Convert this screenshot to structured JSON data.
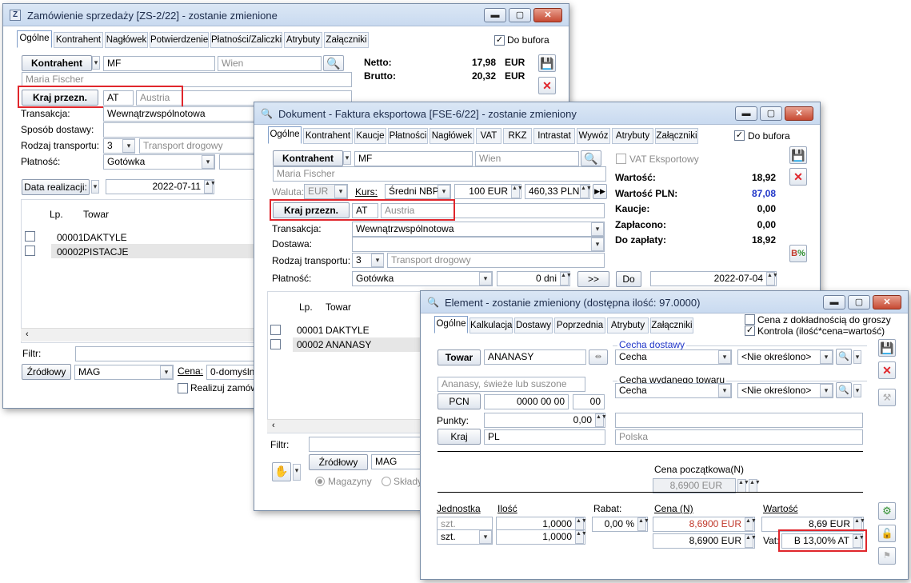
{
  "colors": {
    "accent": "#1f35c8",
    "red": "#e0262c",
    "red_text": "#c0392b"
  },
  "win1": {
    "title": "Zamówienie sprzedaży [ZS-2/22] - zostanie zmienione",
    "tabs": [
      "Ogólne",
      "Kontrahent",
      "Nagłówek",
      "Potwierdzenie",
      "Płatności/Zaliczki",
      "Atrybuty",
      "Załączniki"
    ],
    "do_bufora": "Do bufora",
    "kontrahent_btn": "Kontrahent",
    "kontrahent_code": "MF",
    "kontrahent_city": "Wien",
    "kontrahent_name": "Maria Fischer",
    "netto_label": "Netto:",
    "netto_value": "17,98",
    "netto_cur": "EUR",
    "brutto_label": "Brutto:",
    "brutto_value": "20,32",
    "brutto_cur": "EUR",
    "kraj_btn": "Kraj przezn.",
    "kraj_code": "AT",
    "kraj_name": "Austria",
    "transakcja_label": "Transakcja:",
    "transakcja_value": "Wewnątrzwspólnotowa",
    "sposob_label": "Sposób dostawy:",
    "rodzaj_label": "Rodzaj transportu:",
    "rodzaj_num": "3",
    "rodzaj_value": "Transport drogowy",
    "platnosc_label": "Płatność:",
    "platnosc_value": "Gotówka",
    "data_btn": "Data realizacji:",
    "data_value": "2022-07-11",
    "col_lp": "Lp.",
    "col_towar": "Towar",
    "rows": [
      {
        "lp": "00001",
        "towar": "DAKTYLE"
      },
      {
        "lp": "00002",
        "towar": "PISTACJE"
      }
    ],
    "filtr_label": "Filtr:",
    "zrodlowy_btn": "Źródłowy",
    "mag": "MAG",
    "cena_label": "Cena:",
    "cena_value": "0-domyślna",
    "realizuj": "Realizuj zamówie"
  },
  "win2": {
    "title": "Dokument - Faktura eksportowa [FSE-6/22]  - zostanie zmieniony",
    "tabs": [
      "Ogólne",
      "Kontrahent",
      "Kaucje",
      "Płatności",
      "Nagłówek",
      "VAT",
      "RKZ",
      "Intrastat",
      "Wywóz",
      "Atrybuty",
      "Załączniki"
    ],
    "do_bufora": "Do bufora",
    "kontrahent_btn": "Kontrahent",
    "kontrahent_code": "MF",
    "kontrahent_city": "Wien",
    "kontrahent_name": "Maria Fischer",
    "vat_eksport": "VAT Eksportowy",
    "waluta_label": "Waluta:",
    "waluta_value": "EUR",
    "kurs_label": "Kurs:",
    "kurs_value": "Średni NBP",
    "kurs_amount": "100 EUR",
    "kurs_pln": "460,33 PLN",
    "kraj_btn": "Kraj przezn.",
    "kraj_code": "AT",
    "kraj_name": "Austria",
    "transakcja_label": "Transakcja:",
    "transakcja_value": "Wewnątrzwspólnotowa",
    "dostawa_label": "Dostawa:",
    "rodzaj_label": "Rodzaj transportu:",
    "rodzaj_num": "3",
    "rodzaj_value": "Transport drogowy",
    "platnosc_label": "Płatność:",
    "platnosc_value": "Gotówka",
    "dni": "0 dni",
    "arrow_btn": ">>",
    "do_btn": "Do",
    "do_date": "2022-07-04",
    "wartosc_label": "Wartość:",
    "wartosc_value": "18,92",
    "wartosc_pln_label": "Wartość PLN:",
    "wartosc_pln_value": "87,08",
    "kaucje_label": "Kaucje:",
    "kaucje_value": "0,00",
    "zaplacono_label": "Zapłacono:",
    "zaplacono_value": "0,00",
    "do_zaplaty_label": "Do zapłaty:",
    "do_zaplaty_value": "18,92",
    "col_lp": "Lp.",
    "col_towar": "Towar",
    "rows": [
      {
        "lp": "00001",
        "towar": "DAKTYLE"
      },
      {
        "lp": "00002",
        "towar": "ANANASY"
      }
    ],
    "filtr_label": "Filtr:",
    "zrodlowy_btn": "Źródłowy",
    "mag": "MAG",
    "magazyny": "Magazyny",
    "sklady": "Składy"
  },
  "win3": {
    "title": "Element - zostanie zmieniony (dostępna ilość: 97.0000)",
    "tabs": [
      "Ogólne",
      "Kalkulacja",
      "Dostawy",
      "Poprzednia",
      "Atrybuty",
      "Załączniki"
    ],
    "cena_dokl": "Cena z dokładnością do groszy",
    "kontrola": "Kontrola (ilość*cena=wartość)",
    "towar_btn": "Towar",
    "towar_value": "ANANASY",
    "cecha_dostawy": "Cecha dostawy",
    "cecha": "Cecha",
    "nie_okreslono": "<Nie określono>",
    "cecha_wydanego": "Cecha wydanego towaru",
    "opis": "Ananasy, świeże lub suszone",
    "pcn_btn": "PCN",
    "pcn_value": "0000 00 00",
    "pcn_suffix": "00",
    "punkty_label": "Punkty:",
    "punkty_value": "0,00",
    "kraj_btn": "Kraj",
    "kraj_code": "PL",
    "kraj_name": "Polska",
    "cena_pocz_label": "Cena początkowa(N)",
    "cena_pocz_value": "8,6900 EUR",
    "jednostka_label": "Jednostka",
    "ilosc_label": "Ilość",
    "rabat_label": "Rabat:",
    "cena_n_label": "Cena (N)",
    "wartosc_label": "Wartość",
    "jedn1": "szt.",
    "ilosc1": "1,0000",
    "rabat_value": "0,00 %",
    "cena1": "8,6900 EUR",
    "wartosc1": "8,69 EUR",
    "jedn2": "szt.",
    "ilosc2": "1,0000",
    "cena2": "8,6900 EUR",
    "vat_label": "Vat:",
    "vat_value": "B 13,00% AT"
  }
}
